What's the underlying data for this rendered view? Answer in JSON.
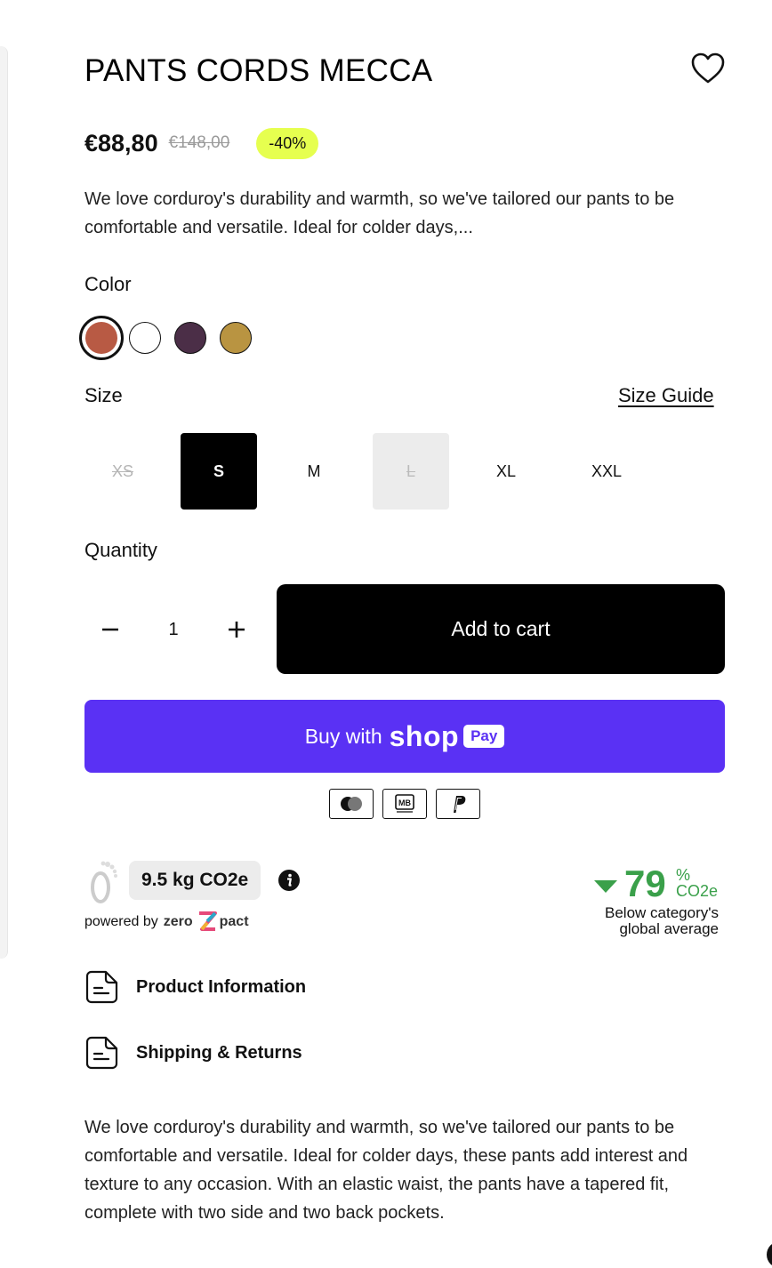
{
  "product": {
    "title": "PANTS CORDS MECCA",
    "price_now": "€88,80",
    "price_old": "€148,00",
    "discount_badge": "-40%",
    "short_description": "We love corduroy's durability and warmth, so we've tailored our pants to be comfortable and versatile. Ideal for colder days,...",
    "long_description": "We love corduroy's durability and warmth, so we've tailored our pants to be comfortable and versatile. Ideal for colder days, these pants add interest and texture to any occasion. With an elastic waist, the pants have a tapered fit, complete with two side and two back pockets."
  },
  "color": {
    "label": "Color",
    "swatches": [
      {
        "name": "rust",
        "hex": "#b85a44",
        "selected": true
      },
      {
        "name": "white",
        "hex": "#ffffff",
        "selected": false
      },
      {
        "name": "plum",
        "hex": "#4b2e47",
        "selected": false
      },
      {
        "name": "ochre",
        "hex": "#b99441",
        "selected": false
      }
    ]
  },
  "size": {
    "label": "Size",
    "guide_link": "Size Guide",
    "options": [
      {
        "label": "XS",
        "state": "unavailable"
      },
      {
        "label": "S",
        "state": "selected"
      },
      {
        "label": "M",
        "state": "available"
      },
      {
        "label": "L",
        "state": "disabled"
      },
      {
        "label": "XL",
        "state": "available"
      },
      {
        "label": "XXL",
        "state": "available"
      }
    ]
  },
  "quantity": {
    "label": "Quantity",
    "value": "1",
    "decrement_icon": "minus-icon",
    "increment_icon": "plus-icon"
  },
  "actions": {
    "add_to_cart": "Add to cart",
    "shop_pay_prefix": "Buy with",
    "shop_pay_brand": "shop",
    "shop_pay_tag": "Pay"
  },
  "payment_methods": [
    "mastercard-icon",
    "multibanco-icon",
    "paypal-icon"
  ],
  "carbon": {
    "value": "9.5 kg CO2e",
    "powered_by": "powered by",
    "provider_a": "zero",
    "provider_b": "pact",
    "percent_below": "79",
    "percent_sign": "%",
    "unit": "CO2e",
    "caption": "Below category's global average",
    "accent": "#3aa04a"
  },
  "accordions": [
    {
      "label": "Product Information",
      "icon": "document-icon"
    },
    {
      "label": "Shipping & Returns",
      "icon": "document-icon"
    }
  ],
  "colors": {
    "shop_pay": "#5a31f4",
    "badge": "#e6ff4f",
    "button": "#000000"
  }
}
